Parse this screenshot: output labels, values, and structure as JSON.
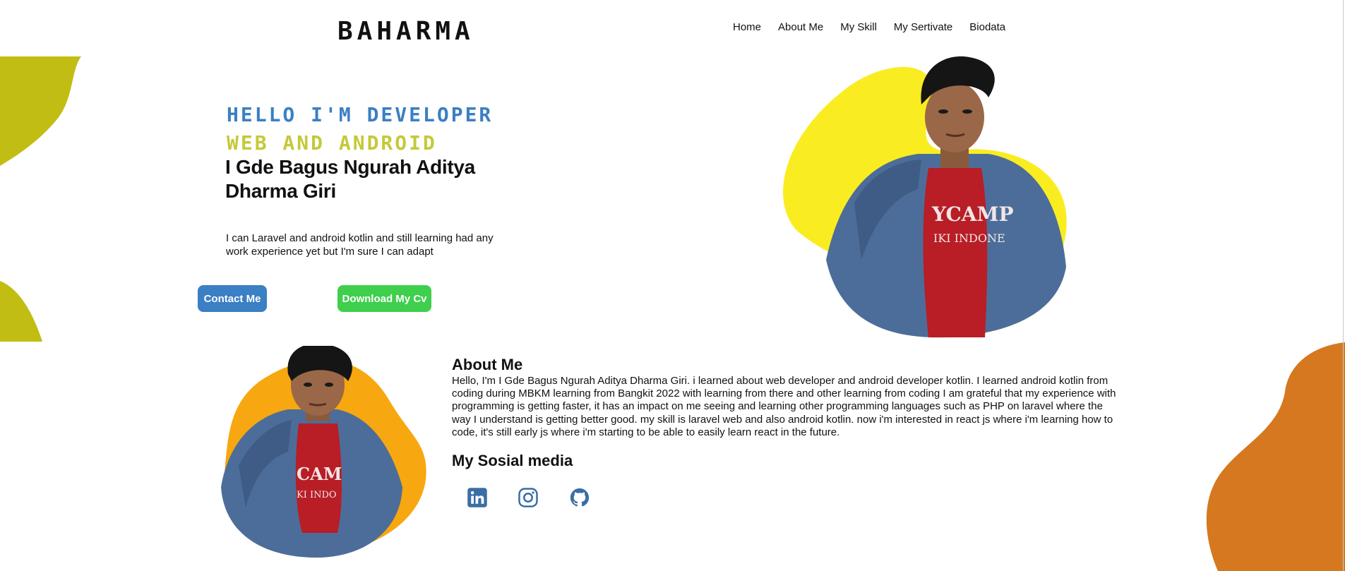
{
  "header": {
    "logo": "BAHARMA",
    "nav": [
      "Home",
      "About Me",
      "My Skill",
      "My Sertivate",
      "Biodata"
    ]
  },
  "hero": {
    "line1": "HELLO I'M DEVELOPER",
    "line2": "WEB AND ANDROID",
    "name": "I Gde Bagus Ngurah Aditya Dharma Giri",
    "description": "I can Laravel and android kotlin and still learning had any work experience yet but I'm sure I can adapt",
    "contact_button": "Contact Me",
    "cv_button": "Download My Cv"
  },
  "about": {
    "title": "About Me",
    "text": "Hello, I'm I Gde Bagus Ngurah Aditya Dharma Giri. i learned about web developer and android developer kotlin. I learned android kotlin from coding during MBKM learning from Bangkit 2022 with learning from there and other learning from coding I am grateful that my experience with programming is getting faster, it has an impact on me seeing and learning other programming languages such as PHP on laravel where the way I understand is getting better good. my skill is laravel web and also android kotlin. now i'm interested in react js where i'm learning how to code, it's still early js where i'm starting to be able to easily learn react in the future.",
    "social_title": "My Sosial media",
    "social_icons": [
      "linkedin-icon",
      "instagram-icon",
      "github-icon"
    ]
  },
  "colors": {
    "accent_blue": "#3b7fc4",
    "accent_olive": "#c4c93a",
    "button_green": "#3fcf4c",
    "blob_yellow": "#f9ed21",
    "blob_orange": "#f7a70f",
    "blob_olive": "#c2bd12",
    "blob_brown_orange": "#d5781f",
    "icon_color": "#3a6ea5"
  }
}
